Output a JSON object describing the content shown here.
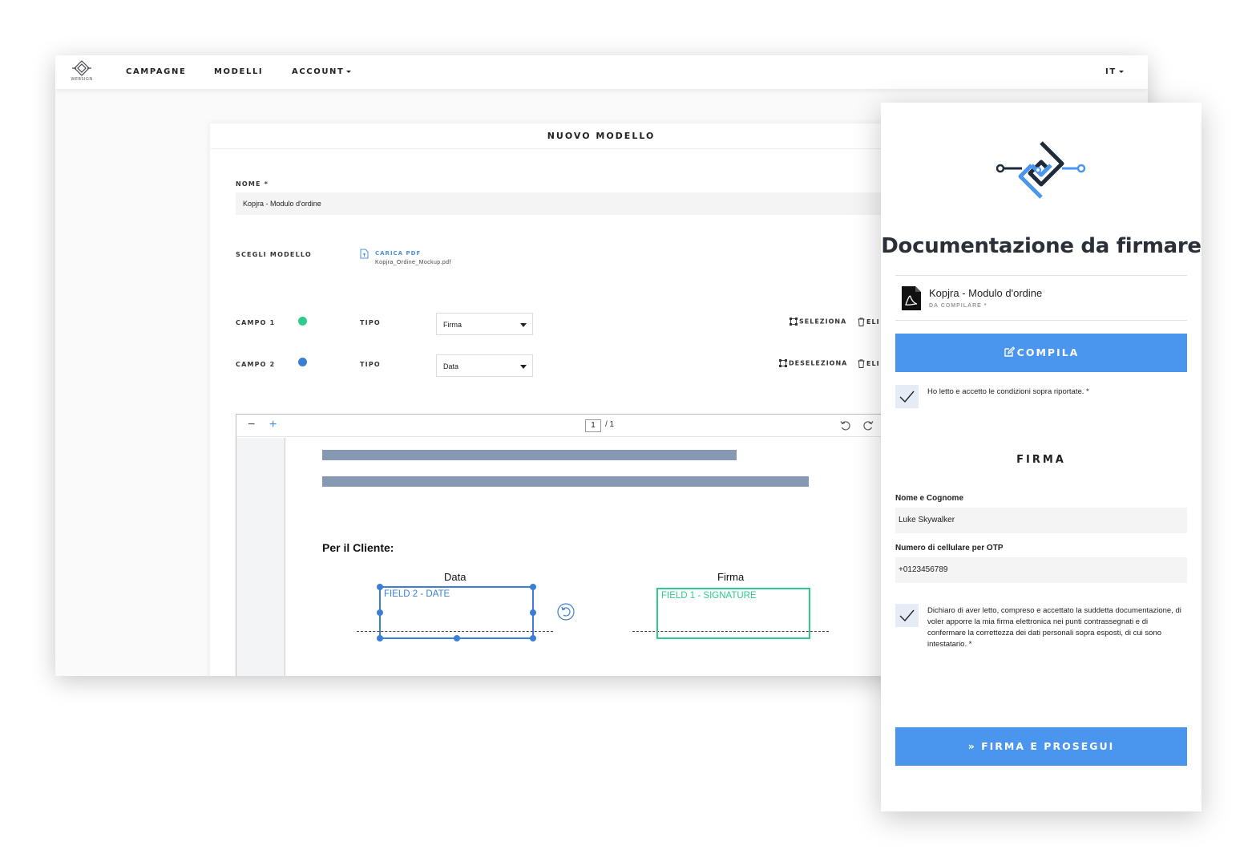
{
  "colors": {
    "accent": "#4a95ee",
    "field_signature": "#2ecc8a",
    "field_date": "#3b7fd4",
    "placeholder_bar": "#8699b2"
  },
  "nav": {
    "logo_text": "WEBSIGN",
    "items": [
      {
        "label": "CAMPAGNE"
      },
      {
        "label": "MODELLI"
      },
      {
        "label": "ACCOUNT"
      }
    ],
    "language": "IT"
  },
  "form": {
    "title": "NUOVO MODELLO",
    "name_label": "NOME *",
    "name_value": "Kopjra - Modulo d'ordine",
    "template_label": "SCEGLI MODELLO",
    "upload_label": "CARICA PDF",
    "upload_file": "Kopjra_Ordine_Mockup.pdf",
    "fields": [
      {
        "label": "CAMPO 1",
        "type_label": "TIPO",
        "type_value": "Firma",
        "action": "SELEZIONA",
        "delete": "ELI",
        "color": "#2ecc8a"
      },
      {
        "label": "CAMPO 2",
        "type_label": "TIPO",
        "type_value": "Data",
        "action": "DESELEZIONA",
        "delete": "ELI",
        "color": "#3b7fd4"
      }
    ]
  },
  "viewer": {
    "zoom_out": "−",
    "zoom_in": "+",
    "page_current": "1",
    "page_total": "/ 1",
    "doc": {
      "heading": "Per il Cliente:",
      "col_date": "Data",
      "col_sign": "Firma",
      "field_date": "FIELD 2 - DATE",
      "field_sign": "FIELD 1 - SIGNATURE"
    }
  },
  "mobile": {
    "title": "Documentazione da firmare",
    "doc_name": "Kopjra - Modulo d'ordine",
    "doc_status": "DA COMPILARE *",
    "compile_button": "COMPILA",
    "accept_text": "Ho letto e accetto le condizioni sopra riportate. *",
    "sign_section": "FIRMA",
    "name_label": "Nome e Cognome",
    "name_value": "Luke Skywalker",
    "phone_label": "Numero di cellulare per OTP",
    "phone_value": "+0123456789",
    "declaration": "Dichiaro di aver letto, compreso e accettato la suddetta documentazione, di voler apporre la mia firma elettronica nei punti contrassegnati e di confermare la correttezza dei dati personali sopra esposti, di cui sono intestatario. *",
    "sign_button": "» FIRMA E PROSEGUI"
  }
}
